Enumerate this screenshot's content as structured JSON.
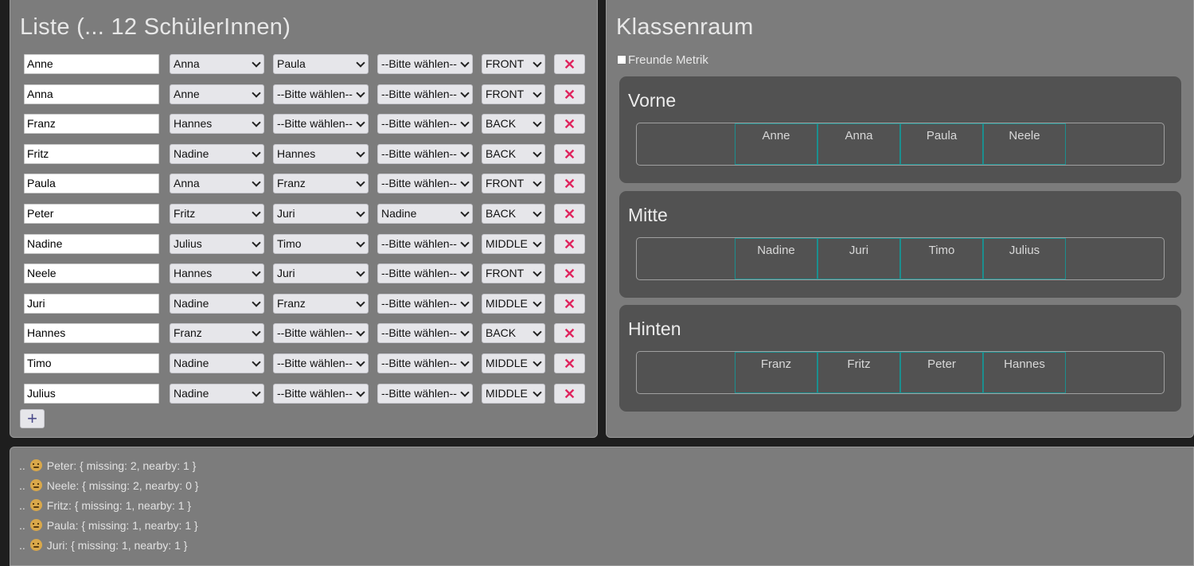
{
  "list": {
    "title": "Liste (... 12 SchülerInnen)",
    "rows": [
      {
        "name": "Anne",
        "f1": "Anna",
        "f2": "Paula",
        "f3": "--Bitte wählen--",
        "pos": "FRONT"
      },
      {
        "name": "Anna",
        "f1": "Anne",
        "f2": "--Bitte wählen--",
        "f3": "--Bitte wählen--",
        "pos": "FRONT"
      },
      {
        "name": "Franz",
        "f1": "Hannes",
        "f2": "--Bitte wählen--",
        "f3": "--Bitte wählen--",
        "pos": "BACK"
      },
      {
        "name": "Fritz",
        "f1": "Nadine",
        "f2": "Hannes",
        "f3": "--Bitte wählen--",
        "pos": "BACK"
      },
      {
        "name": "Paula",
        "f1": "Anna",
        "f2": "Franz",
        "f3": "--Bitte wählen--",
        "pos": "FRONT"
      },
      {
        "name": "Peter",
        "f1": "Fritz",
        "f2": "Juri",
        "f3": "Nadine",
        "pos": "BACK"
      },
      {
        "name": "Nadine",
        "f1": "Julius",
        "f2": "Timo",
        "f3": "--Bitte wählen--",
        "pos": "MIDDLE"
      },
      {
        "name": "Neele",
        "f1": "Hannes",
        "f2": "Juri",
        "f3": "--Bitte wählen--",
        "pos": "FRONT"
      },
      {
        "name": "Juri",
        "f1": "Nadine",
        "f2": "Franz",
        "f3": "--Bitte wählen--",
        "pos": "MIDDLE"
      },
      {
        "name": "Hannes",
        "f1": "Franz",
        "f2": "--Bitte wählen--",
        "f3": "--Bitte wählen--",
        "pos": "BACK"
      },
      {
        "name": "Timo",
        "f1": "Nadine",
        "f2": "--Bitte wählen--",
        "f3": "--Bitte wählen--",
        "pos": "MIDDLE"
      },
      {
        "name": "Julius",
        "f1": "Nadine",
        "f2": "--Bitte wählen--",
        "f3": "--Bitte wählen--",
        "pos": "MIDDLE"
      }
    ],
    "delete_glyph": "✕",
    "add_glyph": "+"
  },
  "room": {
    "title": "Klassenraum",
    "metric_label": "Freunde Metrik",
    "zones": [
      {
        "title": "Vorne",
        "seats": [
          "Anne",
          "Anna",
          "Paula",
          "Neele"
        ]
      },
      {
        "title": "Mitte",
        "seats": [
          "Nadine",
          "Juri",
          "Timo",
          "Julius"
        ]
      },
      {
        "title": "Hinten",
        "seats": [
          "Franz",
          "Fritz",
          "Peter",
          "Hannes"
        ]
      }
    ]
  },
  "log": {
    "lines": [
      {
        "prefix": "..",
        "text": "Peter: { missing: 2, nearby: 1 }",
        "icon": "worried-face-icon"
      },
      {
        "prefix": "..",
        "text": "Neele: { missing: 2, nearby: 0 }",
        "icon": "worried-face-icon"
      },
      {
        "prefix": "..",
        "text": "Fritz: { missing: 1, nearby: 1 }",
        "icon": "neutral-face-icon"
      },
      {
        "prefix": "..",
        "text": "Paula: { missing: 1, nearby: 1 }",
        "icon": "neutral-face-icon"
      },
      {
        "prefix": "..",
        "text": "Juri: { missing: 1, nearby: 1 }",
        "icon": "neutral-face-icon"
      }
    ]
  },
  "colors": {
    "delete": "#e0245e",
    "seat_border": "#1b8f8f",
    "panel": "#7c7c7c",
    "zone": "#525252"
  }
}
